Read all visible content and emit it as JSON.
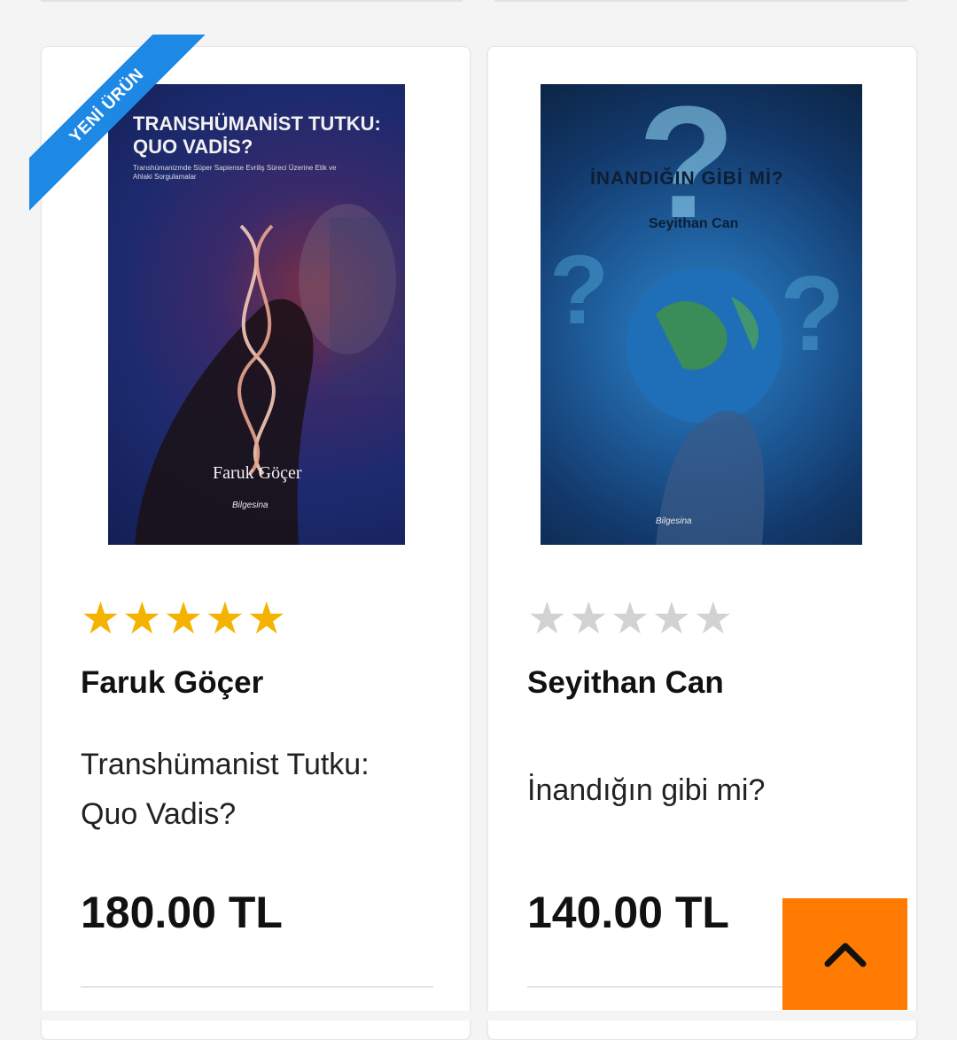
{
  "products": [
    {
      "badge": "YENİ ÜRÜN",
      "cover": {
        "title": "TRANSHÜMANİST TUTKU: QUO VADİS?",
        "subtitle": "Transhümanizmde Süper Sapiense Evriliş Süreci Üzerine Etik ve Ahlaki Sorgulamalar",
        "author": "Faruk Göçer",
        "publisher": "Bilgesina"
      },
      "rating": 5,
      "stars": [
        "★",
        "★",
        "★",
        "★",
        "★"
      ],
      "author": "Faruk Göçer",
      "title": "Transhümanist Tutku: Quo Vadis?",
      "price": "180.00 TL"
    },
    {
      "cover": {
        "title": "İNANDIĞIN GİBİ Mİ?",
        "author": "Seyithan Can",
        "publisher": "Bilgesina"
      },
      "rating": 0,
      "stars": [
        "★",
        "★",
        "★",
        "★",
        "★"
      ],
      "author": "Seyithan Can",
      "title": "İnandığın gibi mi?",
      "price": "140.00 TL"
    }
  ],
  "scroll_top": {
    "icon": "chevron-up-icon"
  },
  "colors": {
    "badge": "#1e88e5",
    "star_on": "#f5b301",
    "star_off": "#d2d2d2",
    "scroll_top": "#ff7a00"
  }
}
